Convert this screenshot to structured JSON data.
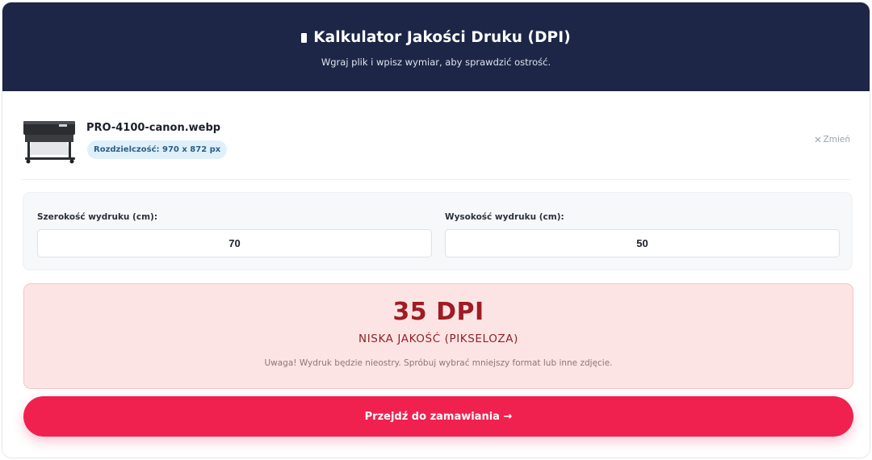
{
  "header": {
    "title": "Kalkulator Jakości Druku (DPI)",
    "subtitle": "Wgraj plik i wpisz wymiar, aby sprawdzić ostrość."
  },
  "file": {
    "name": "PRO-4100-canon.webp",
    "resolution": "Rozdzielczość: 970 x 872 px",
    "change_label": "Zmień",
    "thumbnail_icon": "printer-thumbnail"
  },
  "dimensions": {
    "width_label": "Szerokość wydruku (cm):",
    "width_value": "70",
    "height_label": "Wysokość wydruku (cm):",
    "height_value": "50"
  },
  "result": {
    "dpi": "35 DPI",
    "quality": "NISKA JAKOŚĆ (PIKSELOZA)",
    "warning": "Uwaga! Wydruk będzie nieostry. Spróbuj wybrać mniejszy format lub inne zdjęcie."
  },
  "cta": {
    "label": "Przejdź do zamawiania →"
  },
  "colors": {
    "header_bg": "#1d2646",
    "accent": "#f0214f",
    "warning_bg": "#fde4e4",
    "warning_text": "#9e1c24",
    "badge_bg": "#dff0fb"
  }
}
